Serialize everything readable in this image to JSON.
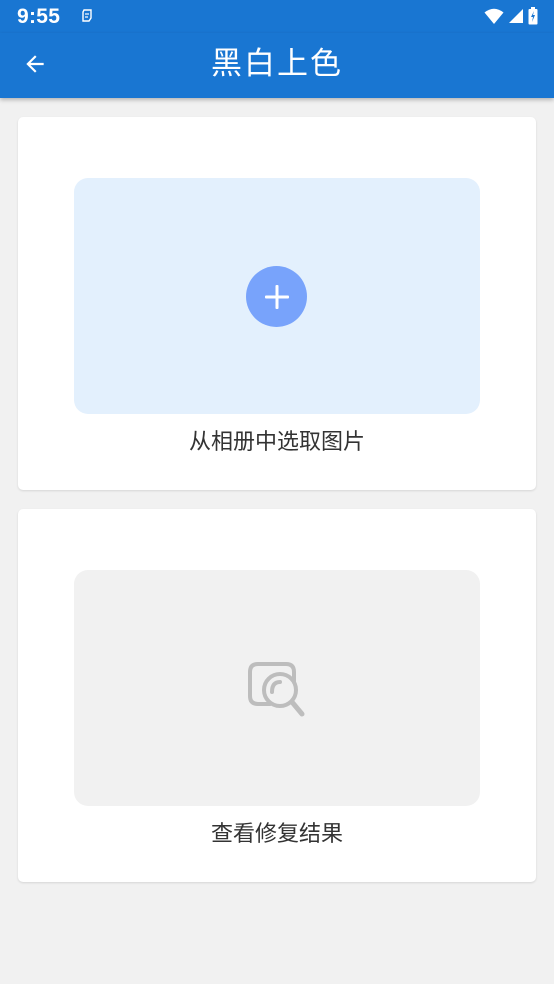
{
  "status_bar": {
    "time": "9:55",
    "background": "#1976d2"
  },
  "app_bar": {
    "title": "黑白上色",
    "back_icon": "arrow-back-icon",
    "background": "#1976d2"
  },
  "cards": {
    "pick": {
      "caption": "从相册中选取图片",
      "icon": "add-circle-icon",
      "area_color": "#e3f0fd",
      "icon_color": "#78a3fb"
    },
    "result": {
      "caption": "查看修复结果",
      "icon": "image-search-icon",
      "area_color": "#f1f1f1",
      "icon_color": "#bdbdbd"
    }
  }
}
